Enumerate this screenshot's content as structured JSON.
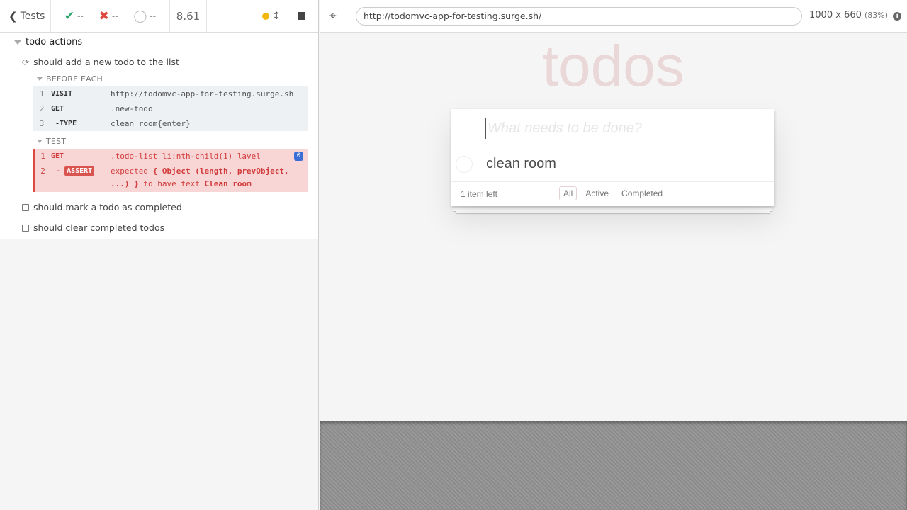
{
  "reporter": {
    "tests_label": "Tests",
    "stats": {
      "passed": "--",
      "failed": "--",
      "pending": "--"
    },
    "duration": "8.61",
    "suite": {
      "title": "todo actions",
      "tests": [
        {
          "title": "should add a new todo to the list",
          "state": "running",
          "hooks": [
            {
              "title": "BEFORE EACH",
              "commands": [
                {
                  "num": "1",
                  "name": "VISIT",
                  "message": "http://todomvc-app-for-testing.surge.sh"
                },
                {
                  "num": "2",
                  "name": "GET",
                  "message": ".new-todo"
                },
                {
                  "num": "3",
                  "name": "-TYPE",
                  "message": "clean room{enter}"
                }
              ]
            },
            {
              "title": "TEST",
              "commands": [
                {
                  "num": "1",
                  "name": "GET",
                  "message": ".todo-list li:nth-child(1) lavel",
                  "badge": "0"
                },
                {
                  "num": "2",
                  "name_prefix": "-",
                  "name": "ASSERT",
                  "message_parts": [
                    "expected",
                    "{ Object (length, prevObject, ...) }",
                    "to have text",
                    "Clean room"
                  ]
                }
              ]
            }
          ]
        },
        {
          "title": "should mark a todo as completed",
          "state": "pending"
        },
        {
          "title": "should clear completed todos",
          "state": "pending"
        }
      ]
    }
  },
  "aut": {
    "url": "http://todomvc-app-for-testing.surge.sh/",
    "viewport": "1000 x 660",
    "scale": "(83%)",
    "app": {
      "title": "todos",
      "new_todo_placeholder": "What needs to be done?",
      "todos": [
        {
          "label": "clean room",
          "completed": false
        }
      ],
      "footer": {
        "count": "1 item left",
        "filters": [
          "All",
          "Active",
          "Completed"
        ],
        "selected_filter": "All"
      }
    }
  },
  "colors": {
    "pass": "#2ea36b",
    "fail": "#e0473e",
    "running_dot": "#f0b90b",
    "badge": "#3b6fd6"
  }
}
